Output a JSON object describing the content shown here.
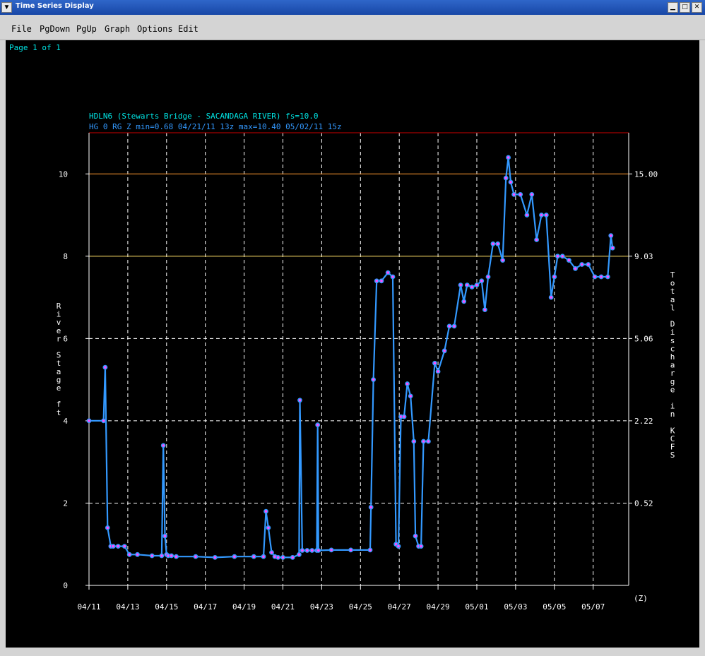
{
  "window": {
    "title": "Time Series Display",
    "menu_glyph": "▼",
    "min_glyph": "▁",
    "max_glyph": "□",
    "close_glyph": "✕"
  },
  "menu": {
    "file": "File",
    "pgdown": "PgDown",
    "pgup": "PgUp",
    "graph": "Graph",
    "options": "Options",
    "edit": "Edit"
  },
  "page_label": "Page 1 of 1",
  "colors": {
    "background": "#000000",
    "text": "#ffffff",
    "title": "#00e5e5",
    "subtitle": "#3399ff",
    "series": "#3399ff",
    "points": "#ff4dff",
    "flood": "#cc0000",
    "action": "#ff9933",
    "minor": "#ffe066",
    "grid": "#ffffff"
  },
  "chart_data": {
    "type": "line",
    "title": "HDLN6 (Stewarts Bridge - SACANDAGA RIVER) fs=10.0",
    "subtitle": "HG 0 RG Z min=0.68 04/21/11 13z max=10.40 05/02/11 15z",
    "ylabel": "River Stage ft",
    "y2label": "Total Discharge in KCFS",
    "xunit": "(Z)",
    "xlim": [
      "04/11",
      "05/08"
    ],
    "ylim": [
      0,
      11
    ],
    "xticks": [
      "04/11",
      "04/13",
      "04/15",
      "04/17",
      "04/19",
      "04/21",
      "04/23",
      "04/25",
      "04/27",
      "04/29",
      "05/01",
      "05/03",
      "05/05",
      "05/07"
    ],
    "yticks": [
      "0",
      "2",
      "4",
      "6",
      "8",
      "10"
    ],
    "y2ticks": [
      {
        "stage": 2,
        "label": "0.52"
      },
      {
        "stage": 4,
        "label": "2.22"
      },
      {
        "stage": 6,
        "label": "5.06"
      },
      {
        "stage": 8,
        "label": "9.03"
      },
      {
        "stage": 10,
        "label": "15.00"
      }
    ],
    "reference_lines": [
      {
        "stage": 11.0,
        "kind": "flood"
      },
      {
        "stage": 10.0,
        "kind": "action"
      },
      {
        "stage": 8.0,
        "kind": "minor"
      }
    ],
    "series": [
      {
        "x": [
          "04/11 00z",
          "04/11 18z",
          "04/11 20z",
          "04/11 23z",
          "04/12 03z",
          "04/12 06z",
          "04/12 12z",
          "04/12 20z",
          "04/13 02z",
          "04/13 12z",
          "04/14 06z",
          "04/14 18z",
          "04/14 20z",
          "04/14 22z",
          "04/15 00z",
          "04/15 02z",
          "04/15 06z",
          "04/15 12z",
          "04/16 12z",
          "04/17 12z",
          "04/18 12z",
          "04/19 12z",
          "04/20 00z",
          "04/20 03z",
          "04/20 06z",
          "04/20 10z",
          "04/20 14z",
          "04/20 18z",
          "04/21 00z",
          "04/21 12z",
          "04/21 20z",
          "04/21 21z",
          "04/22 00z",
          "04/22 06z",
          "04/22 12z",
          "04/22 18z",
          "04/22 19z",
          "04/22 20z",
          "04/23 12z",
          "04/24 12z",
          "04/25 12z",
          "04/25 13z",
          "04/25 16z",
          "04/25 20z",
          "04/26 02z",
          "04/26 10z",
          "04/26 16z",
          "04/26 20z",
          "04/26 23z",
          "04/27 02z",
          "04/27 06z",
          "04/27 10z",
          "04/27 14z",
          "04/27 18z",
          "04/27 20z",
          "04/28 00z",
          "04/28 03z",
          "04/28 06z",
          "04/28 12z",
          "04/28 20z",
          "04/29 00z",
          "04/29 08z",
          "04/29 14z",
          "04/29 20z",
          "04/30 04z",
          "04/30 08z",
          "04/30 12z",
          "04/30 18z",
          "05/01 00z",
          "05/01 06z",
          "05/01 10z",
          "05/01 14z",
          "05/01 20z",
          "05/02 02z",
          "05/02 08z",
          "05/02 12z",
          "05/02 15z",
          "05/02 18z",
          "05/02 22z",
          "05/03 06z",
          "05/03 14z",
          "05/03 20z",
          "05/04 02z",
          "05/04 08z",
          "05/04 14z",
          "05/04 20z",
          "05/05 00z",
          "05/05 04z",
          "05/05 10z",
          "05/05 18z",
          "05/06 02z",
          "05/06 10z",
          "05/06 18z",
          "05/07 02z",
          "05/07 10z",
          "05/07 18z",
          "05/07 22z",
          "05/08 00z"
        ],
        "y": [
          4.0,
          4.0,
          5.3,
          1.4,
          0.95,
          0.95,
          0.95,
          0.95,
          0.75,
          0.75,
          0.72,
          0.72,
          3.4,
          1.2,
          0.75,
          0.72,
          0.72,
          0.7,
          0.7,
          0.68,
          0.7,
          0.7,
          0.7,
          1.8,
          1.4,
          0.8,
          0.7,
          0.68,
          0.68,
          0.68,
          0.75,
          4.5,
          0.85,
          0.85,
          0.85,
          0.85,
          3.9,
          0.85,
          0.86,
          0.86,
          0.86,
          1.9,
          5.0,
          7.4,
          7.4,
          7.6,
          7.5,
          1.0,
          0.95,
          4.1,
          4.1,
          4.9,
          4.6,
          3.5,
          1.2,
          0.95,
          0.95,
          3.5,
          3.5,
          5.4,
          5.2,
          5.7,
          6.3,
          6.3,
          7.3,
          6.9,
          7.3,
          7.25,
          7.3,
          7.4,
          6.7,
          7.5,
          8.3,
          8.3,
          7.9,
          9.9,
          10.4,
          9.8,
          9.5,
          9.5,
          9.0,
          9.5,
          8.4,
          9.0,
          9.0,
          7.0,
          7.5,
          8.0,
          8.0,
          7.9,
          7.7,
          7.8,
          7.8,
          7.5,
          7.5,
          7.5,
          8.5,
          8.2
        ]
      }
    ]
  }
}
